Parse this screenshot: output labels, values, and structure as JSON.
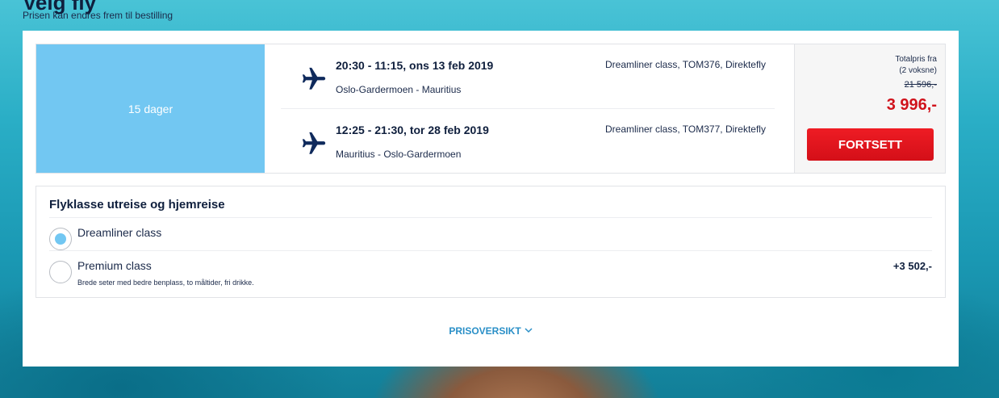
{
  "page": {
    "heading": "Velg fly",
    "subheading": "Prisen kan endres frem til bestilling"
  },
  "trip": {
    "duration": "15 dager",
    "outbound": {
      "time": "20:30 - 11:15, ons 13 feb 2019",
      "route": "Oslo-Gardermoen - Mauritius",
      "details": "Dreamliner class, TOM376, Direktefly",
      "icon": "plane-outbound-icon"
    },
    "return": {
      "time": "12:25 - 21:30, tor 28 feb 2019",
      "route": "Mauritius - Oslo-Gardermoen",
      "details": "Dreamliner class, TOM377, Direktefly",
      "icon": "plane-return-icon"
    },
    "price": {
      "label_line1": "Totalpris fra",
      "label_line2": "(2 voksne)",
      "old": "21 596,-",
      "new": "3 996,-"
    },
    "continue_label": "FORTSETT"
  },
  "flight_class": {
    "title": "Flyklasse utreise og hjemreise",
    "options": [
      {
        "label": "Dreamliner class",
        "description": "",
        "price": "",
        "selected": true
      },
      {
        "label": "Premium class",
        "description": "Brede seter med bedre benplass, to måltider, fri drikke.",
        "price": "+3 502,-",
        "selected": false
      }
    ]
  },
  "overview_link": "PRISOVERSIKT",
  "colors": {
    "accent_blue": "#72c7f2",
    "price_red": "#d0121b",
    "button_red": "#ee1c24",
    "link_blue": "#2a8fc7",
    "navy": "#0f1f3d"
  }
}
